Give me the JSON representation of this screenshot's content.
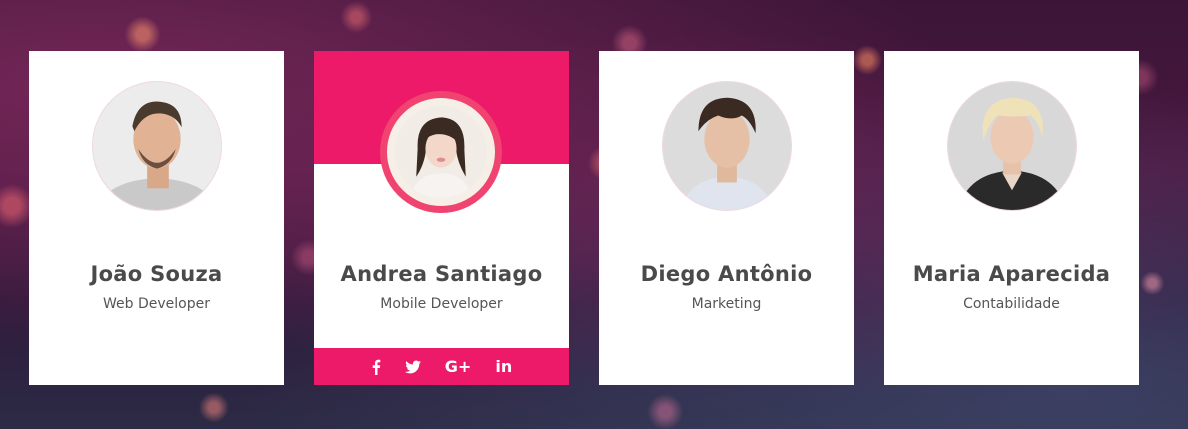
{
  "cards": [
    {
      "name": "João Souza",
      "role": "Web Developer"
    },
    {
      "name": "Andrea Santiago",
      "role": "Mobile Developer"
    },
    {
      "name": "Diego Antônio",
      "role": "Marketing"
    },
    {
      "name": "Maria Aparecida",
      "role": "Contabilidade"
    }
  ],
  "social": {
    "icons": [
      "facebook-icon",
      "twitter-icon",
      "google-plus-icon",
      "linkedin-icon"
    ],
    "google_plus_label": "G+",
    "linkedin_label": "in",
    "facebook_label": "f"
  },
  "colors": {
    "accent": "#ec1a68",
    "ring": "#f0436f",
    "card_bg": "#ffffff",
    "name_text": "#4a4a4a"
  }
}
